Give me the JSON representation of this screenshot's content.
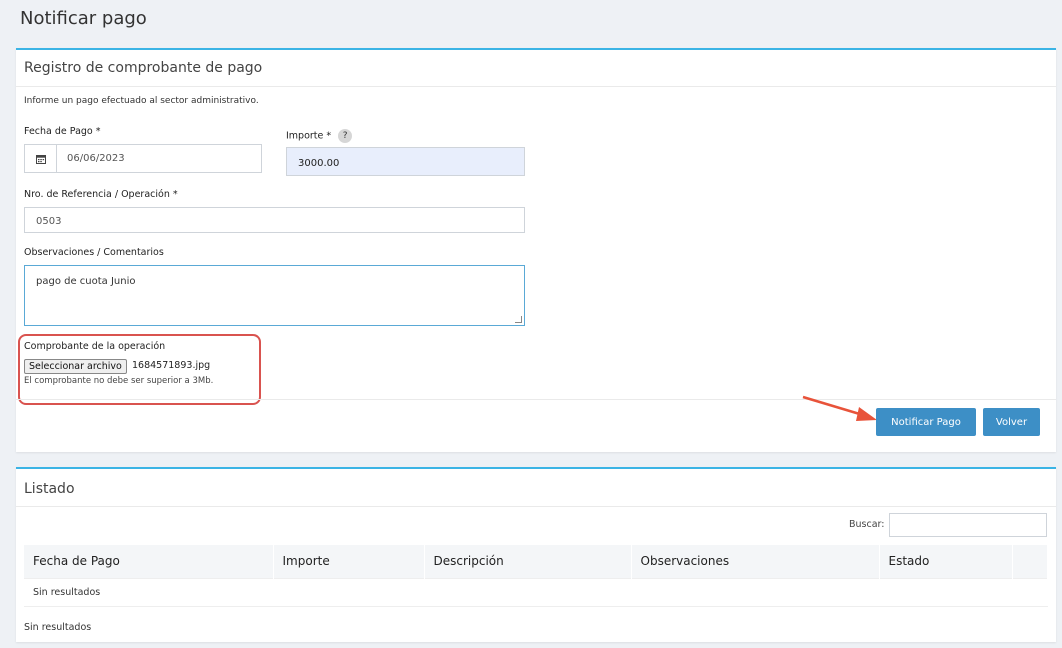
{
  "page": {
    "title": "Notificar pago"
  },
  "form": {
    "title": "Registro de comprobante de pago",
    "intro": "Informe un pago efectuado al sector administrativo.",
    "fecha_label": "Fecha de Pago *",
    "fecha_value": "06/06/2023",
    "importe_label": "Importe *",
    "importe_help": "?",
    "importe_value": "3000.00",
    "ref_label": "Nro. de Referencia / Operación *",
    "ref_value": "0503",
    "obs_label": "Observaciones / Comentarios",
    "obs_value": "pago de cuota Junio",
    "comprobante_label": "Comprobante de la operación",
    "file_button": "Seleccionar archivo",
    "file_name": "1684571893.jpg",
    "file_help": "El comprobante no debe ser superior a 3Mb.",
    "submit_label": "Notificar Pago",
    "back_label": "Volver",
    "calendar_icon": "calendar-icon"
  },
  "listado": {
    "title": "Listado",
    "search_label": "Buscar:",
    "columns": [
      "Fecha de Pago",
      "Importe",
      "Descripción",
      "Observaciones",
      "Estado"
    ],
    "empty_row": "Sin resultados",
    "footer": "Sin resultados"
  },
  "colors": {
    "accent": "#3bb4e5",
    "button": "#3d8fc6",
    "highlight": "#d9534f"
  }
}
